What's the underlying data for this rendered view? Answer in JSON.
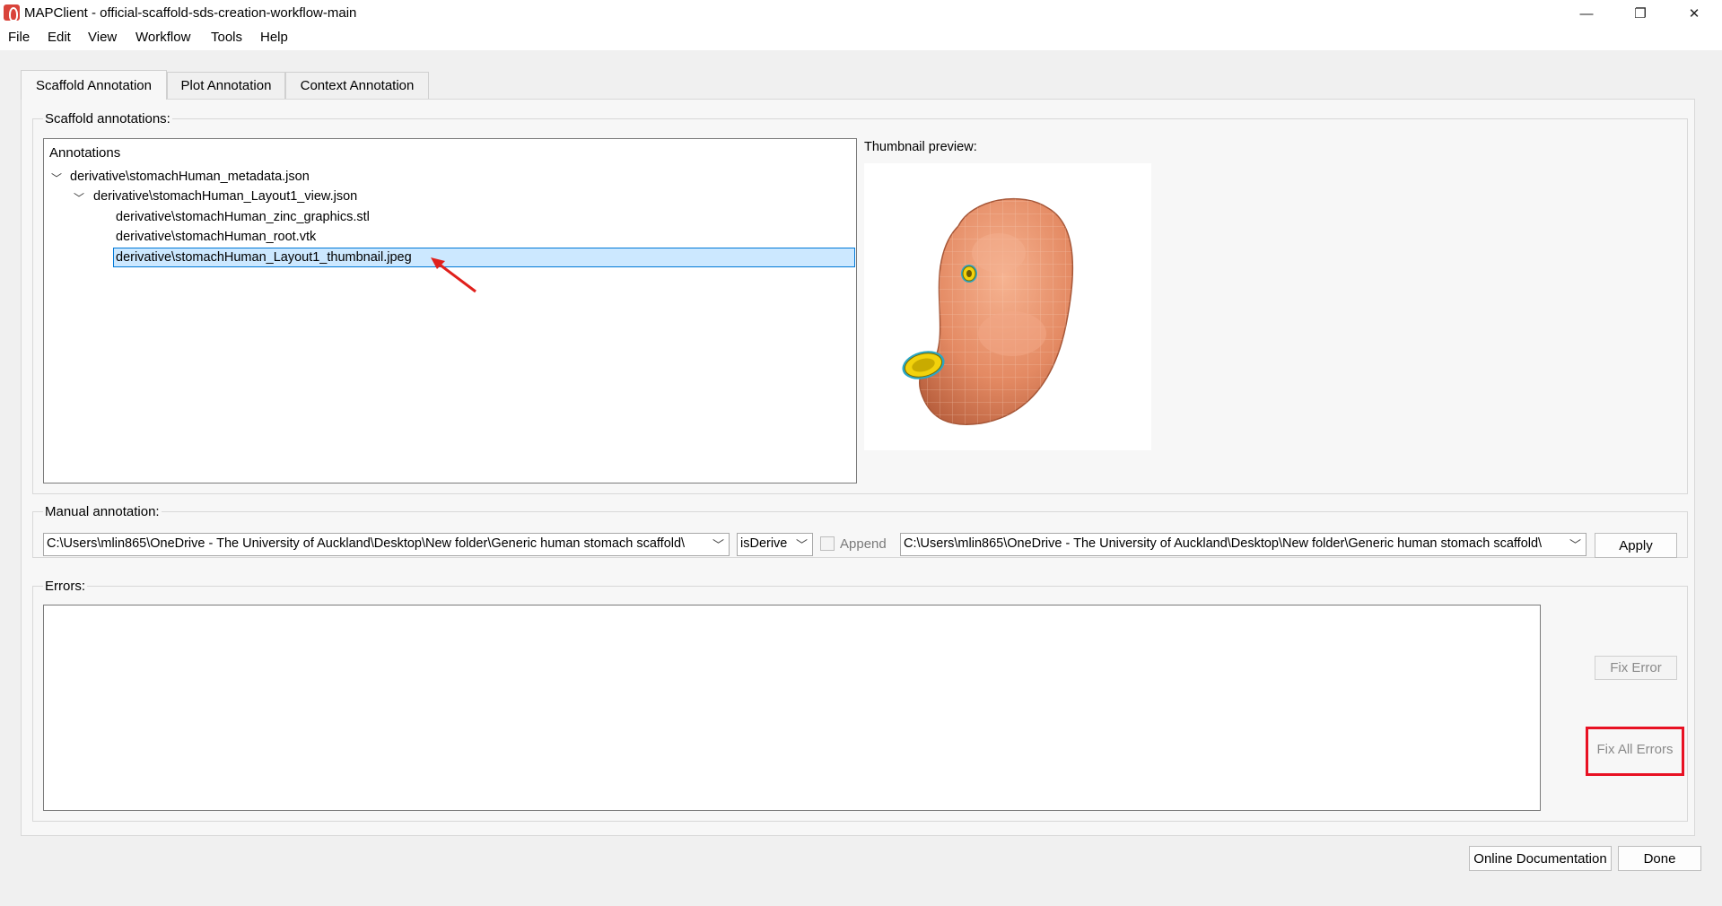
{
  "window": {
    "title": "MAPClient - official-scaffold-sds-creation-workflow-main",
    "minimize_glyph": "—",
    "restore_glyph": "❐",
    "close_glyph": "✕"
  },
  "menu": {
    "items": [
      "File",
      "Edit",
      "View",
      "Workflow",
      "Tools",
      "Help"
    ]
  },
  "tabs": [
    {
      "label": "Scaffold Annotation",
      "active": true
    },
    {
      "label": "Plot Annotation",
      "active": false
    },
    {
      "label": "Context Annotation",
      "active": false
    }
  ],
  "scaffold_annotations": {
    "group_label": "Scaffold annotations:",
    "tree_header": "Annotations",
    "tree": [
      {
        "label": "derivative\\stomachHuman_metadata.json",
        "expanded": true
      },
      {
        "label": "derivative\\stomachHuman_Layout1_view.json",
        "expanded": true
      },
      {
        "label": "derivative\\stomachHuman_zinc_graphics.stl"
      },
      {
        "label": "derivative\\stomachHuman_root.vtk"
      },
      {
        "label": "derivative\\stomachHuman_Layout1_thumbnail.jpeg",
        "selected": true
      }
    ],
    "thumbnail_label": "Thumbnail preview:"
  },
  "manual_annotation": {
    "group_label": "Manual annotation:",
    "subject_value": "C:\\Users\\mlin865\\OneDrive - The University of Auckland\\Desktop\\New folder\\Generic human stomach scaffold\\",
    "predicate_value": "isDerive",
    "append_label": "Append",
    "append_checked": false,
    "object_value": "C:\\Users\\mlin865\\OneDrive - The University of Auckland\\Desktop\\New folder\\Generic human stomach scaffold\\",
    "apply_label": "Apply"
  },
  "errors": {
    "group_label": "Errors:",
    "fix_error_label": "Fix Error",
    "fix_all_label": "Fix All Errors"
  },
  "footer": {
    "online_doc_label": "Online Documentation",
    "done_label": "Done"
  },
  "colors": {
    "selection": "#cce8ff",
    "selection_border": "#0078d7",
    "highlight_red": "#e81123",
    "arrow_red": "#e0201c",
    "stomach_fill": "#e8946c",
    "ring_yellow": "#f2d20c"
  }
}
